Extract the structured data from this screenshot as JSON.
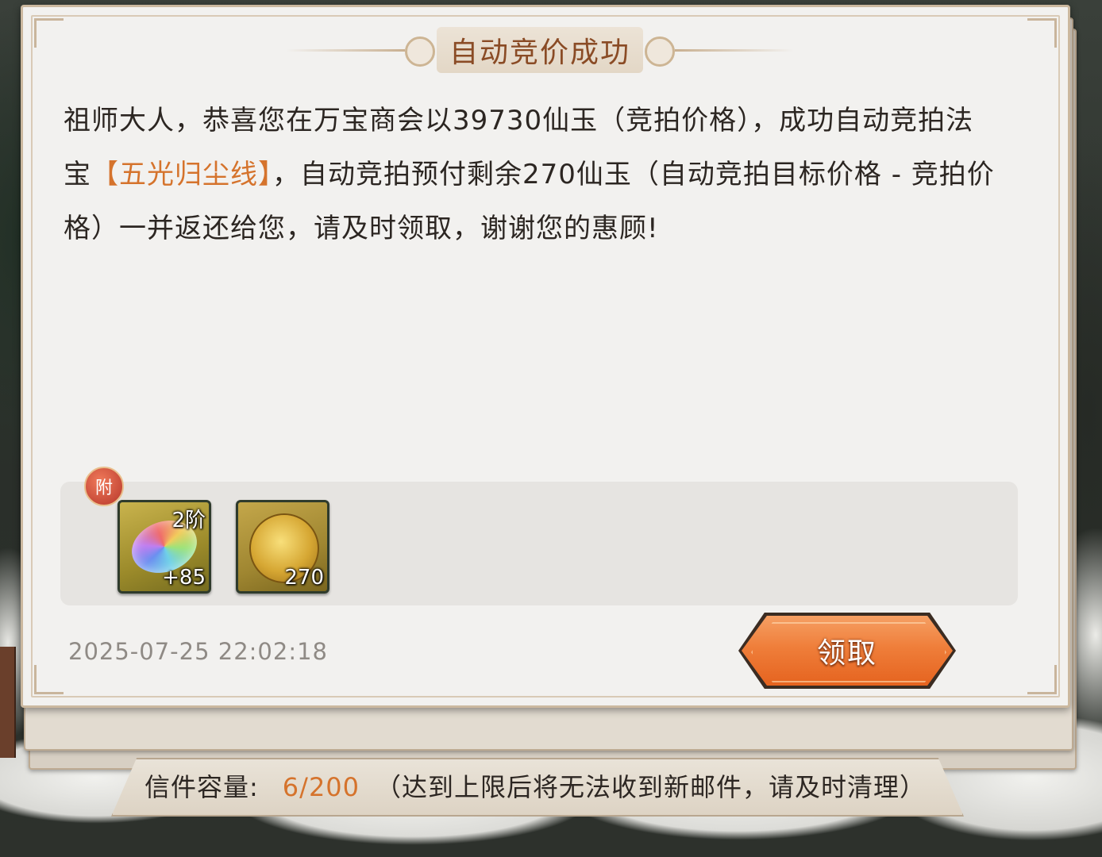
{
  "mail": {
    "title": "自动竞价成功",
    "body_intro": "祖师大人，恭喜您在万宝商会以39730仙玉（竞拍价格），成功自动竞拍法宝",
    "item_name": "【五光归尘线】",
    "body_rest": "，自动竞拍预付剩余270仙玉（自动竞拍目标价格 - 竞拍价格）一并返还给您，请及时领取，谢谢您的惠顾!",
    "attachment_badge": "附",
    "attachments": [
      {
        "icon": "rainbow-thread-icon",
        "tier": "2阶",
        "count": "+85"
      },
      {
        "icon": "golden-dragon-jade-icon",
        "count": "270"
      }
    ],
    "timestamp": "2025-07-25 22:02:18",
    "claim_label": "领取"
  },
  "footer": {
    "capacity_label": "信件容量:",
    "capacity_value": "6/200",
    "capacity_hint": "（达到上限后将无法收到新邮件，请及时清理）"
  },
  "colors": {
    "highlight": "#d5732c",
    "title": "#8a4b25",
    "button": "#ef7e3a"
  }
}
